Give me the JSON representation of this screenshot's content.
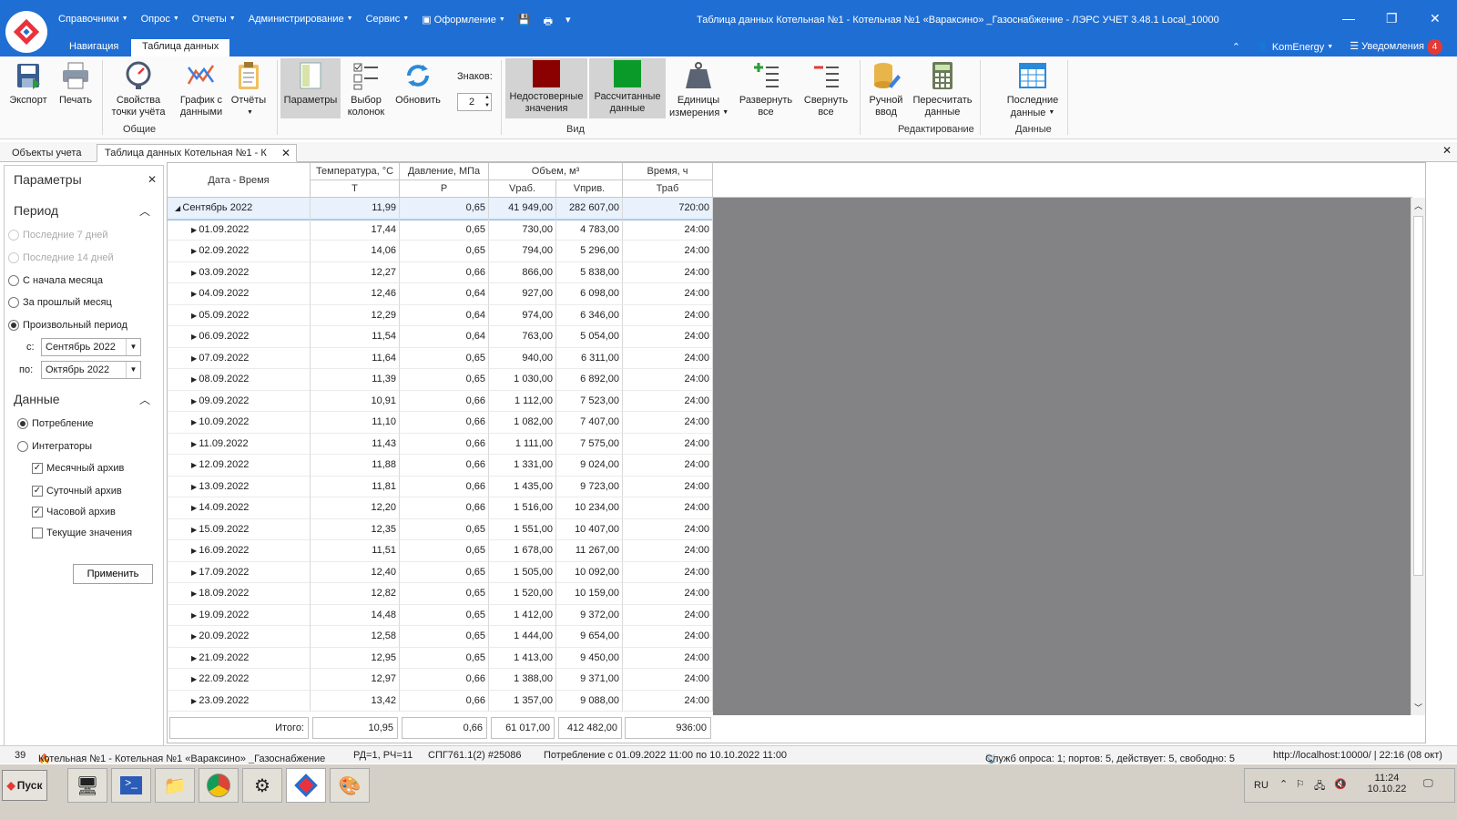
{
  "menu": {
    "items": [
      "Справочники",
      "Опрос",
      "Отчеты",
      "Администрирование",
      "Сервис",
      "Оформление"
    ]
  },
  "window": {
    "title": "Таблица данных Котельная №1 - Котельная №1 «Вараксино» _Газоснабжение - ЛЭРС УЧЕТ 3.48.1 Local_10000"
  },
  "tabs": {
    "navigation": "Навигация",
    "table": "Таблица данных"
  },
  "user": {
    "name": "KomEnergy",
    "notifications_label": "Уведомления",
    "notifications_count": "4"
  },
  "ribbon": {
    "export": "Экспорт",
    "print": "Печать",
    "point_props": "Свойства точки учёта",
    "chart": "График с данными",
    "reports": "Отчёты",
    "group_general": "Общие",
    "params": "Параметры",
    "column_choice": "Выбор колонок",
    "refresh": "Обновить",
    "digits_label": "Знаков:",
    "digits_value": "2",
    "invalid": "Недостоверные значения",
    "calculated": "Рассчитанные данные",
    "units": "Единицы измерения",
    "expand_all": "Развернуть все",
    "collapse_all": "Свернуть все",
    "group_view": "Вид",
    "manual_input": "Ручной ввод",
    "recalc": "Пересчитать данные",
    "group_edit": "Редактирование",
    "last_data": "Последние данные",
    "group_data": "Данные",
    "colors": {
      "invalid": "#8b0000",
      "calculated": "#0a9a2a"
    }
  },
  "doc_tabs": {
    "objects": "Объекты учета",
    "table": "Таблица данных Котельная №1 - К"
  },
  "params_panel": {
    "title": "Параметры",
    "period_title": "Период",
    "last7": "Последние 7 дней",
    "last14": "Последние 14 дней",
    "month_start": "С начала месяца",
    "prev_month": "За прошлый месяц",
    "custom": "Произвольный период",
    "from_label": "с:",
    "from_value": "Сентябрь 2022",
    "to_label": "по:",
    "to_value": "Октябрь 2022",
    "data_title": "Данные",
    "consumption": "Потребление",
    "integrators": "Интеграторы",
    "monthly": "Месячный архив",
    "daily": "Суточный архив",
    "hourly": "Часовой архив",
    "current": "Текущие значения",
    "apply": "Применить"
  },
  "grid": {
    "headers": {
      "date": "Дата - Время",
      "temp": "Температура, °C",
      "temp_sub": "T",
      "pressure": "Давление, МПа",
      "pressure_sub": "P",
      "volume": "Объем, м³",
      "vrab": "Vраб.",
      "vpriv": "Vприв.",
      "time": "Время, ч",
      "trab": "Траб"
    },
    "group": {
      "date": "Сентябрь 2022",
      "t": "11,99",
      "p": "0,65",
      "vr": "41 949,00",
      "vp": "282 607,00",
      "tr": "720:00"
    },
    "rows": [
      {
        "date": "01.09.2022",
        "t": "17,44",
        "p": "0,65",
        "vr": "730,00",
        "vp": "4 783,00",
        "tr": "24:00"
      },
      {
        "date": "02.09.2022",
        "t": "14,06",
        "p": "0,65",
        "vr": "794,00",
        "vp": "5 296,00",
        "tr": "24:00"
      },
      {
        "date": "03.09.2022",
        "t": "12,27",
        "p": "0,66",
        "vr": "866,00",
        "vp": "5 838,00",
        "tr": "24:00"
      },
      {
        "date": "04.09.2022",
        "t": "12,46",
        "p": "0,64",
        "vr": "927,00",
        "vp": "6 098,00",
        "tr": "24:00"
      },
      {
        "date": "05.09.2022",
        "t": "12,29",
        "p": "0,64",
        "vr": "974,00",
        "vp": "6 346,00",
        "tr": "24:00"
      },
      {
        "date": "06.09.2022",
        "t": "11,54",
        "p": "0,64",
        "vr": "763,00",
        "vp": "5 054,00",
        "tr": "24:00"
      },
      {
        "date": "07.09.2022",
        "t": "11,64",
        "p": "0,65",
        "vr": "940,00",
        "vp": "6 311,00",
        "tr": "24:00"
      },
      {
        "date": "08.09.2022",
        "t": "11,39",
        "p": "0,65",
        "vr": "1 030,00",
        "vp": "6 892,00",
        "tr": "24:00"
      },
      {
        "date": "09.09.2022",
        "t": "10,91",
        "p": "0,66",
        "vr": "1 112,00",
        "vp": "7 523,00",
        "tr": "24:00"
      },
      {
        "date": "10.09.2022",
        "t": "11,10",
        "p": "0,66",
        "vr": "1 082,00",
        "vp": "7 407,00",
        "tr": "24:00"
      },
      {
        "date": "11.09.2022",
        "t": "11,43",
        "p": "0,66",
        "vr": "1 111,00",
        "vp": "7 575,00",
        "tr": "24:00"
      },
      {
        "date": "12.09.2022",
        "t": "11,88",
        "p": "0,66",
        "vr": "1 331,00",
        "vp": "9 024,00",
        "tr": "24:00"
      },
      {
        "date": "13.09.2022",
        "t": "11,81",
        "p": "0,66",
        "vr": "1 435,00",
        "vp": "9 723,00",
        "tr": "24:00"
      },
      {
        "date": "14.09.2022",
        "t": "12,20",
        "p": "0,66",
        "vr": "1 516,00",
        "vp": "10 234,00",
        "tr": "24:00"
      },
      {
        "date": "15.09.2022",
        "t": "12,35",
        "p": "0,65",
        "vr": "1 551,00",
        "vp": "10 407,00",
        "tr": "24:00"
      },
      {
        "date": "16.09.2022",
        "t": "11,51",
        "p": "0,65",
        "vr": "1 678,00",
        "vp": "11 267,00",
        "tr": "24:00"
      },
      {
        "date": "17.09.2022",
        "t": "12,40",
        "p": "0,65",
        "vr": "1 505,00",
        "vp": "10 092,00",
        "tr": "24:00"
      },
      {
        "date": "18.09.2022",
        "t": "12,82",
        "p": "0,65",
        "vr": "1 520,00",
        "vp": "10 159,00",
        "tr": "24:00"
      },
      {
        "date": "19.09.2022",
        "t": "14,48",
        "p": "0,65",
        "vr": "1 412,00",
        "vp": "9 372,00",
        "tr": "24:00"
      },
      {
        "date": "20.09.2022",
        "t": "12,58",
        "p": "0,65",
        "vr": "1 444,00",
        "vp": "9 654,00",
        "tr": "24:00"
      },
      {
        "date": "21.09.2022",
        "t": "12,95",
        "p": "0,65",
        "vr": "1 413,00",
        "vp": "9 450,00",
        "tr": "24:00"
      },
      {
        "date": "22.09.2022",
        "t": "12,97",
        "p": "0,66",
        "vr": "1 388,00",
        "vp": "9 371,00",
        "tr": "24:00"
      },
      {
        "date": "23.09.2022",
        "t": "13,42",
        "p": "0,66",
        "vr": "1 357,00",
        "vp": "9 088,00",
        "tr": "24:00"
      }
    ],
    "footer": {
      "label": "Итого:",
      "t": "10,95",
      "p": "0,66",
      "vr": "61 017,00",
      "vp": "412 482,00",
      "tr": "936:00"
    }
  },
  "status": {
    "count": "39",
    "object": "Котельная №1 - Котельная №1 «Вараксино» _Газоснабжение",
    "rd": "РД=1, РЧ=11",
    "device": "СПГ761.1(2) #25086",
    "period": "Потребление с 01.09.2022 11:00 по 10.10.2022 11:00",
    "services": "Служб опроса: 1; портов: 5, действует: 5, свободно: 5",
    "url": "http://localhost:10000/ | 22:16 (08 окт)"
  },
  "taskbar": {
    "start": "Пуск",
    "lang": "RU",
    "time": "11:24",
    "date": "10.10.22"
  }
}
